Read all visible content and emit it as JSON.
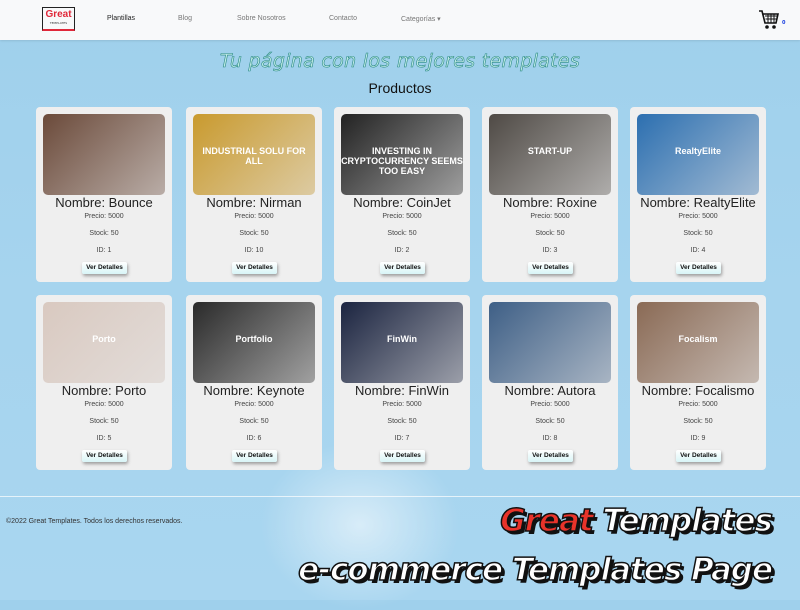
{
  "header": {
    "logo": "Great",
    "logo_sub": "TEMPLATES",
    "nav": [
      "Plantillas",
      "Blog",
      "Sobre Nosotros",
      "Contacto",
      "Categorías ▾"
    ],
    "cart_count": "0"
  },
  "main": {
    "headline": "Tu página con los mejores templates",
    "section_title": "Productos",
    "products": [
      {
        "name": "Nombre: Bounce",
        "price": "Precio: 5000",
        "stock": "Stock: 50",
        "id": "ID: 1",
        "button": "Ver Detalles",
        "thumb_text": "",
        "color": "#6b4a3a"
      },
      {
        "name": "Nombre: Nirman",
        "price": "Precio: 5000",
        "stock": "Stock: 50",
        "id": "ID: 10",
        "button": "Ver Detalles",
        "thumb_text": "INDUSTRIAL SOLU FOR ALL",
        "color": "#c99a2e"
      },
      {
        "name": "Nombre: CoinJet",
        "price": "Precio: 5000",
        "stock": "Stock: 50",
        "id": "ID: 2",
        "button": "Ver Detalles",
        "thumb_text": "INVESTING IN CRYPTOCURRENCY SEEMS TOO EASY",
        "color": "#222"
      },
      {
        "name": "Nombre: Roxine",
        "price": "Precio: 5000",
        "stock": "Stock: 50",
        "id": "ID: 3",
        "button": "Ver Detalles",
        "thumb_text": "START-UP",
        "color": "#4f4a45"
      },
      {
        "name": "Nombre: RealtyElite",
        "price": "Precio: 5000",
        "stock": "Stock: 50",
        "id": "ID: 4",
        "button": "Ver Detalles",
        "thumb_text": "RealtyElite",
        "color": "#2c6fb0"
      },
      {
        "name": "Nombre: Porto",
        "price": "Precio: 5000",
        "stock": "Stock: 50",
        "id": "ID: 5",
        "button": "Ver Detalles",
        "thumb_text": "Porto",
        "color": "#d9c9c0"
      },
      {
        "name": "Nombre: Keynote",
        "price": "Precio: 5000",
        "stock": "Stock: 50",
        "id": "ID: 6",
        "button": "Ver Detalles",
        "thumb_text": "Portfolio",
        "color": "#2a2a2a"
      },
      {
        "name": "Nombre: FinWin",
        "price": "Precio: 5000",
        "stock": "Stock: 50",
        "id": "ID: 7",
        "button": "Ver Detalles",
        "thumb_text": "FinWin",
        "color": "#1b2440"
      },
      {
        "name": "Nombre: Autora",
        "price": "Precio: 5000",
        "stock": "Stock: 50",
        "id": "ID: 8",
        "button": "Ver Detalles",
        "thumb_text": "",
        "color": "#3e5f86"
      },
      {
        "name": "Nombre: Focalismo",
        "price": "Precio: 5000",
        "stock": "Stock: 50",
        "id": "ID: 9",
        "button": "Ver Detalles",
        "thumb_text": "Focalism",
        "color": "#8a6a55"
      }
    ]
  },
  "footer": {
    "copyright": "©2022 Great Templates. Todos los derechos reservados."
  },
  "overlay": {
    "word1": "Great",
    "word2": "Templates",
    "line2": "e-commerce Templates Page"
  }
}
